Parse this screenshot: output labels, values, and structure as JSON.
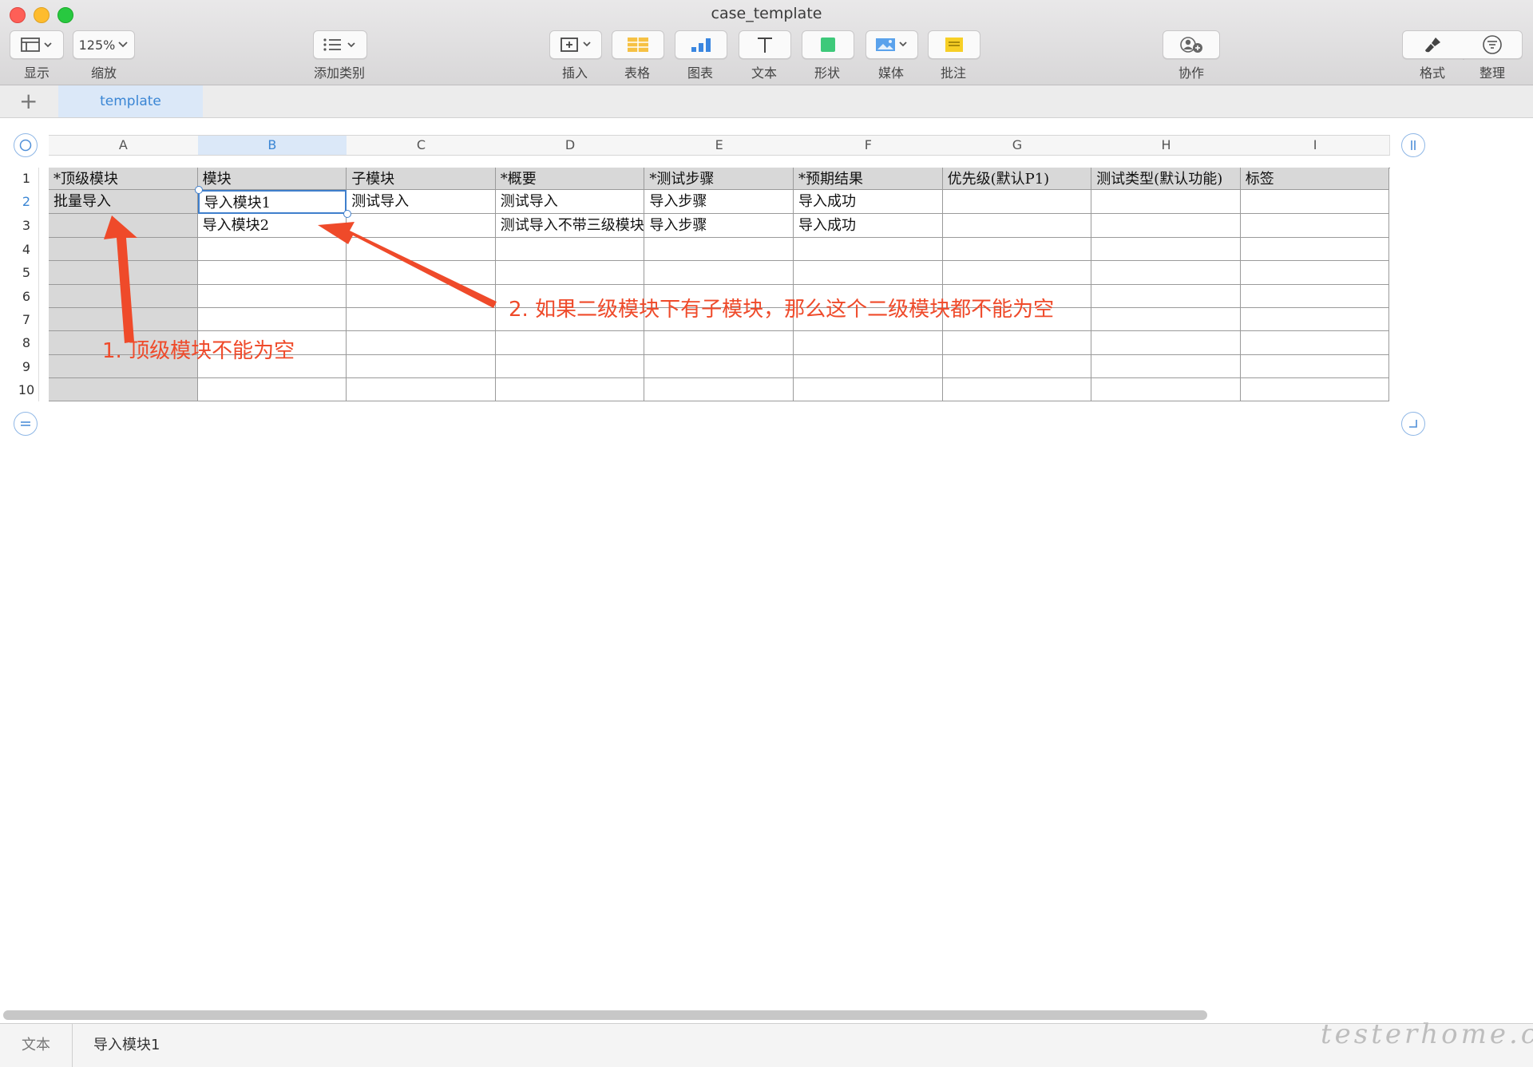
{
  "window": {
    "title": "case_template"
  },
  "toolbar": {
    "view": "显示",
    "zoom_value": "125%",
    "zoom": "缩放",
    "add_category": "添加类别",
    "insert": "插入",
    "table": "表格",
    "chart": "图表",
    "text": "文本",
    "shape": "形状",
    "media": "媒体",
    "comment": "批注",
    "collaborate": "协作",
    "format": "格式",
    "organize": "整理"
  },
  "sheets": {
    "add": "+",
    "active": "template"
  },
  "grid": {
    "columns": [
      "A",
      "B",
      "C",
      "D",
      "E",
      "F",
      "G",
      "H",
      "I"
    ],
    "selected_column": "B",
    "rows": [
      "1",
      "2",
      "3",
      "4",
      "5",
      "6",
      "7",
      "8",
      "9",
      "10"
    ],
    "selected_row": "2",
    "cells": [
      [
        "*顶级模块",
        "模块",
        "子模块",
        "*概要",
        "*测试步骤",
        "*预期结果",
        "优先级(默认P1)",
        "测试类型(默认功能)",
        "标签"
      ],
      [
        "批量导入",
        "导入模块1",
        "测试导入",
        "测试导入",
        "导入步骤",
        "导入成功",
        "",
        "",
        ""
      ],
      [
        "",
        "导入模块2",
        "",
        "测试导入不带三级模块",
        "导入步骤",
        "导入成功",
        "",
        "",
        ""
      ],
      [
        "",
        "",
        "",
        "",
        "",
        "",
        "",
        "",
        ""
      ],
      [
        "",
        "",
        "",
        "",
        "",
        "",
        "",
        "",
        ""
      ],
      [
        "",
        "",
        "",
        "",
        "",
        "",
        "",
        "",
        ""
      ],
      [
        "",
        "",
        "",
        "",
        "",
        "",
        "",
        "",
        ""
      ],
      [
        "",
        "",
        "",
        "",
        "",
        "",
        "",
        "",
        ""
      ],
      [
        "",
        "",
        "",
        "",
        "",
        "",
        "",
        "",
        ""
      ],
      [
        "",
        "",
        "",
        "",
        "",
        "",
        "",
        "",
        ""
      ]
    ]
  },
  "annotations": {
    "note1": "1. 顶级模块不能为空",
    "note2": "2. 如果二级模块下有子模块，那么这个二级模块都不能为空",
    "color": "#ef4a2a"
  },
  "formula_bar": {
    "type": "文本",
    "value": "导入模块1"
  },
  "watermark": "testerhome.com",
  "colors": {
    "selection": "#3f7fcc",
    "header_fill": "#d8d8d8",
    "tab_fill": "#dbe8f8"
  }
}
